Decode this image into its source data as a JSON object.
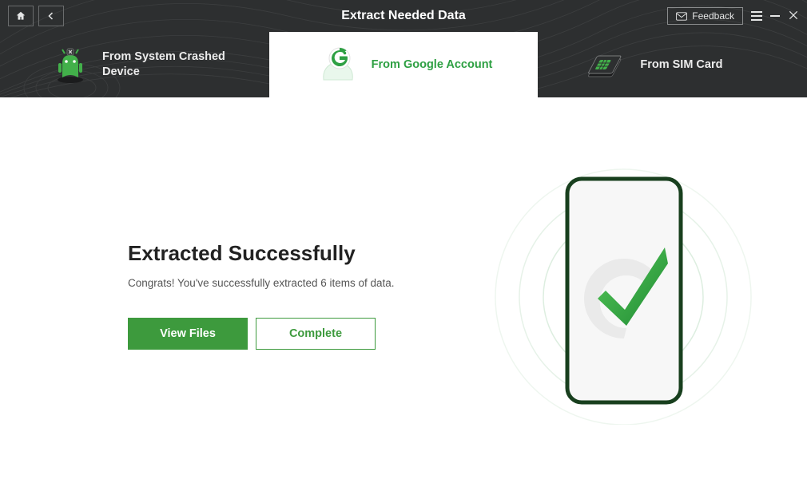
{
  "window": {
    "title": "Extract Needed Data",
    "feedback_label": "Feedback"
  },
  "tabs": [
    {
      "label": "From System Crashed Device"
    },
    {
      "label": "From Google Account"
    },
    {
      "label": "From SIM Card"
    }
  ],
  "result": {
    "heading": "Extracted Successfully",
    "subtext": "Congrats! You've successfully extracted 6 items of data.",
    "view_files_label": "View Files",
    "complete_label": "Complete"
  },
  "colors": {
    "accent": "#3d9a3d",
    "accent_text": "#2ea043"
  }
}
